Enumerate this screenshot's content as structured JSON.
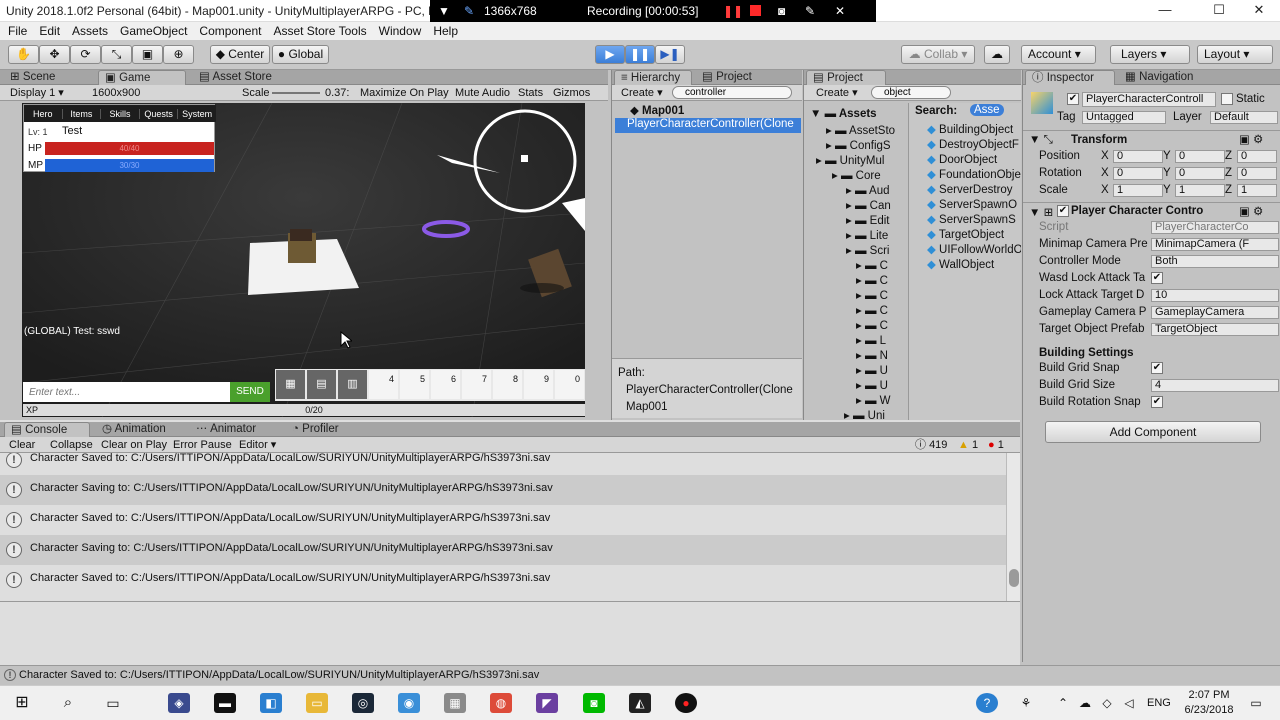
{
  "window": {
    "title": "Unity 2018.1.0f2 Personal (64bit) - Map001.unity - UnityMultiplayerARPG - PC, M..."
  },
  "recorder": {
    "resolution": "1366x768",
    "status": "Recording [00:00:53]"
  },
  "window_controls": {
    "minimize": "—",
    "maximize": "☐",
    "close": "✕"
  },
  "menu": [
    "File",
    "Edit",
    "Assets",
    "GameObject",
    "Component",
    "Asset Store Tools",
    "Window",
    "Help"
  ],
  "toolbar": {
    "center": "Center",
    "global": "Global",
    "collab": "Collab ▾",
    "account": "Account",
    "layers": "Layers",
    "layout": "Layout"
  },
  "scene_tabs": {
    "scene": "Scene",
    "game": "Game",
    "asset_store": "Asset Store"
  },
  "game_bar": {
    "display": "Display 1",
    "resolution": "1600x900",
    "scale_label": "Scale",
    "scale_value": "0.37:",
    "maximize": "Maximize On Play",
    "mute": "Mute Audio",
    "stats": "Stats",
    "gizmos": "Gizmos"
  },
  "game_ui": {
    "tabs": [
      "Hero",
      "Items",
      "Skills",
      "Quests",
      "System"
    ],
    "level": "Lv: 1",
    "player_name": "Test",
    "hp_label": "HP",
    "hp_value": "40/40",
    "hp_fraction": 1.0,
    "mp_label": "MP",
    "mp_value": "30/30",
    "mp_fraction": 1.0,
    "chat_message": "(GLOBAL) Test: sswd",
    "chat_placeholder": "Enter text...",
    "send": "SEND",
    "hotkeys": [
      "4",
      "5",
      "6",
      "7",
      "8",
      "9",
      "0"
    ],
    "xp_label": "XP",
    "xp_value": "0/20",
    "xp_fraction": 0
  },
  "hierarchy": {
    "tab": "Hierarchy",
    "project_tab": "Project",
    "create": "Create ▾",
    "search": "controller",
    "scene": "Map001",
    "selected": "PlayerCharacterController(Clone",
    "path_label": "Path:",
    "path_1": "PlayerCharacterController(Clone",
    "path_2": "Map001"
  },
  "project": {
    "tab": "Project",
    "create": "Create ▾",
    "search": "object",
    "assets": "Assets",
    "search_label": "Search:",
    "search_scope": "Asse",
    "tree": [
      "AssetSto",
      "ConfigS",
      "UnityMul",
      "Core",
      "Aud",
      "Can",
      "Edit",
      "Lite",
      "Scri",
      "C",
      "C",
      "C",
      "C",
      "C",
      "L",
      "N",
      "U",
      "U",
      "W",
      "Uni"
    ],
    "results": [
      "BuildingObject",
      "DestroyObjectF",
      "DoorObject",
      "FoundationObje",
      "ServerDestroy",
      "ServerSpawnO",
      "ServerSpawnS",
      "TargetObject",
      "UIFollowWorldO",
      "WallObject"
    ]
  },
  "inspector": {
    "tab": "Inspector",
    "nav_tab": "Navigation",
    "object_name": "PlayerCharacterControll",
    "static": "Static",
    "tag_label": "Tag",
    "tag": "Untagged",
    "layer_label": "Layer",
    "layer": "Default",
    "transform": "Transform",
    "position": "Position",
    "rotation": "Rotation",
    "scale": "Scale",
    "x": "X",
    "y": "Y",
    "z": "Z",
    "pos": [
      "0",
      "0",
      "0"
    ],
    "rot": [
      "0",
      "0",
      "0"
    ],
    "scl": [
      "1",
      "1",
      "1"
    ],
    "component": "Player Character Contro",
    "script_label": "Script",
    "script": "PlayerCharacterCo",
    "minimap_label": "Minimap Camera Pre",
    "minimap": "MinimapCamera (F",
    "controller_label": "Controller Mode",
    "controller": "Both",
    "wasd_label": "Wasd Lock Attack Ta",
    "lock_label": "Lock Attack Target D",
    "lock": "10",
    "gameplay_label": "Gameplay Camera P",
    "gameplay": "GameplayCamera",
    "target_label": "Target Object Prefab",
    "target": "TargetObject",
    "building": "Building Settings",
    "grid_snap": "Build Grid Snap",
    "grid_size": "Build Grid Size",
    "grid_size_value": "4",
    "rot_snap": "Build Rotation Snap",
    "add_component": "Add Component"
  },
  "console": {
    "tab": "Console",
    "animation": "Animation",
    "animator": "Animator",
    "profiler": "Profiler",
    "clear": "Clear",
    "collapse": "Collapse",
    "clear_on_play": "Clear on Play",
    "error_pause": "Error Pause",
    "editor": "Editor ▾",
    "info_count": "419",
    "warn_count": "1",
    "err_count": "1",
    "rows": [
      "Character Saved to: C:/Users/ITTIPON/AppData/LocalLow/SURIYUN/UnityMultiplayerARPG/hS3973ni.sav",
      "Character Saving to: C:/Users/ITTIPON/AppData/LocalLow/SURIYUN/UnityMultiplayerARPG/hS3973ni.sav",
      "Character Saved to: C:/Users/ITTIPON/AppData/LocalLow/SURIYUN/UnityMultiplayerARPG/hS3973ni.sav",
      "Character Saving to: C:/Users/ITTIPON/AppData/LocalLow/SURIYUN/UnityMultiplayerARPG/hS3973ni.sav",
      "Character Saved to: C:/Users/ITTIPON/AppData/LocalLow/SURIYUN/UnityMultiplayerARPG/hS3973ni.sav"
    ],
    "status": "Character Saved to: C:/Users/ITTIPON/AppData/LocalLow/SURIYUN/UnityMultiplayerARPG/hS3973ni.sav"
  },
  "taskbar": {
    "language": "ENG",
    "time": "2:07 PM",
    "date": "6/23/2018"
  },
  "colors": {
    "accent": "#3c7fd8",
    "hp": "#c8231f",
    "mp": "#1f63d6",
    "send": "#4aa02c"
  }
}
